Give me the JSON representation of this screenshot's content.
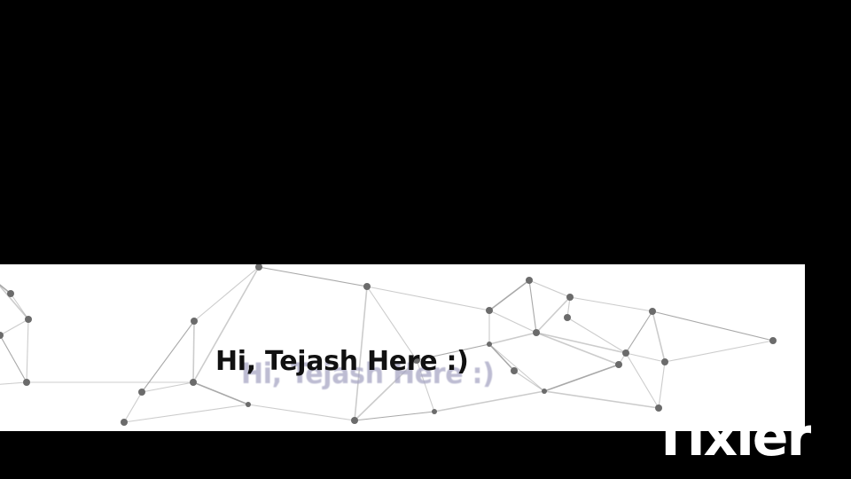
{
  "greeting": {
    "text": "Hi, Tejash Here :)",
    "echo_text": "Hi, Tejash Here :)"
  },
  "watermark": {
    "text": "Tixier"
  },
  "colors": {
    "background": "#000000",
    "banner": "#ffffff",
    "network_line": "#9a9a9a",
    "network_node": "#6b6b6b",
    "greeting_echo": "#a7a6c4",
    "watermark": "#ffffff"
  }
}
